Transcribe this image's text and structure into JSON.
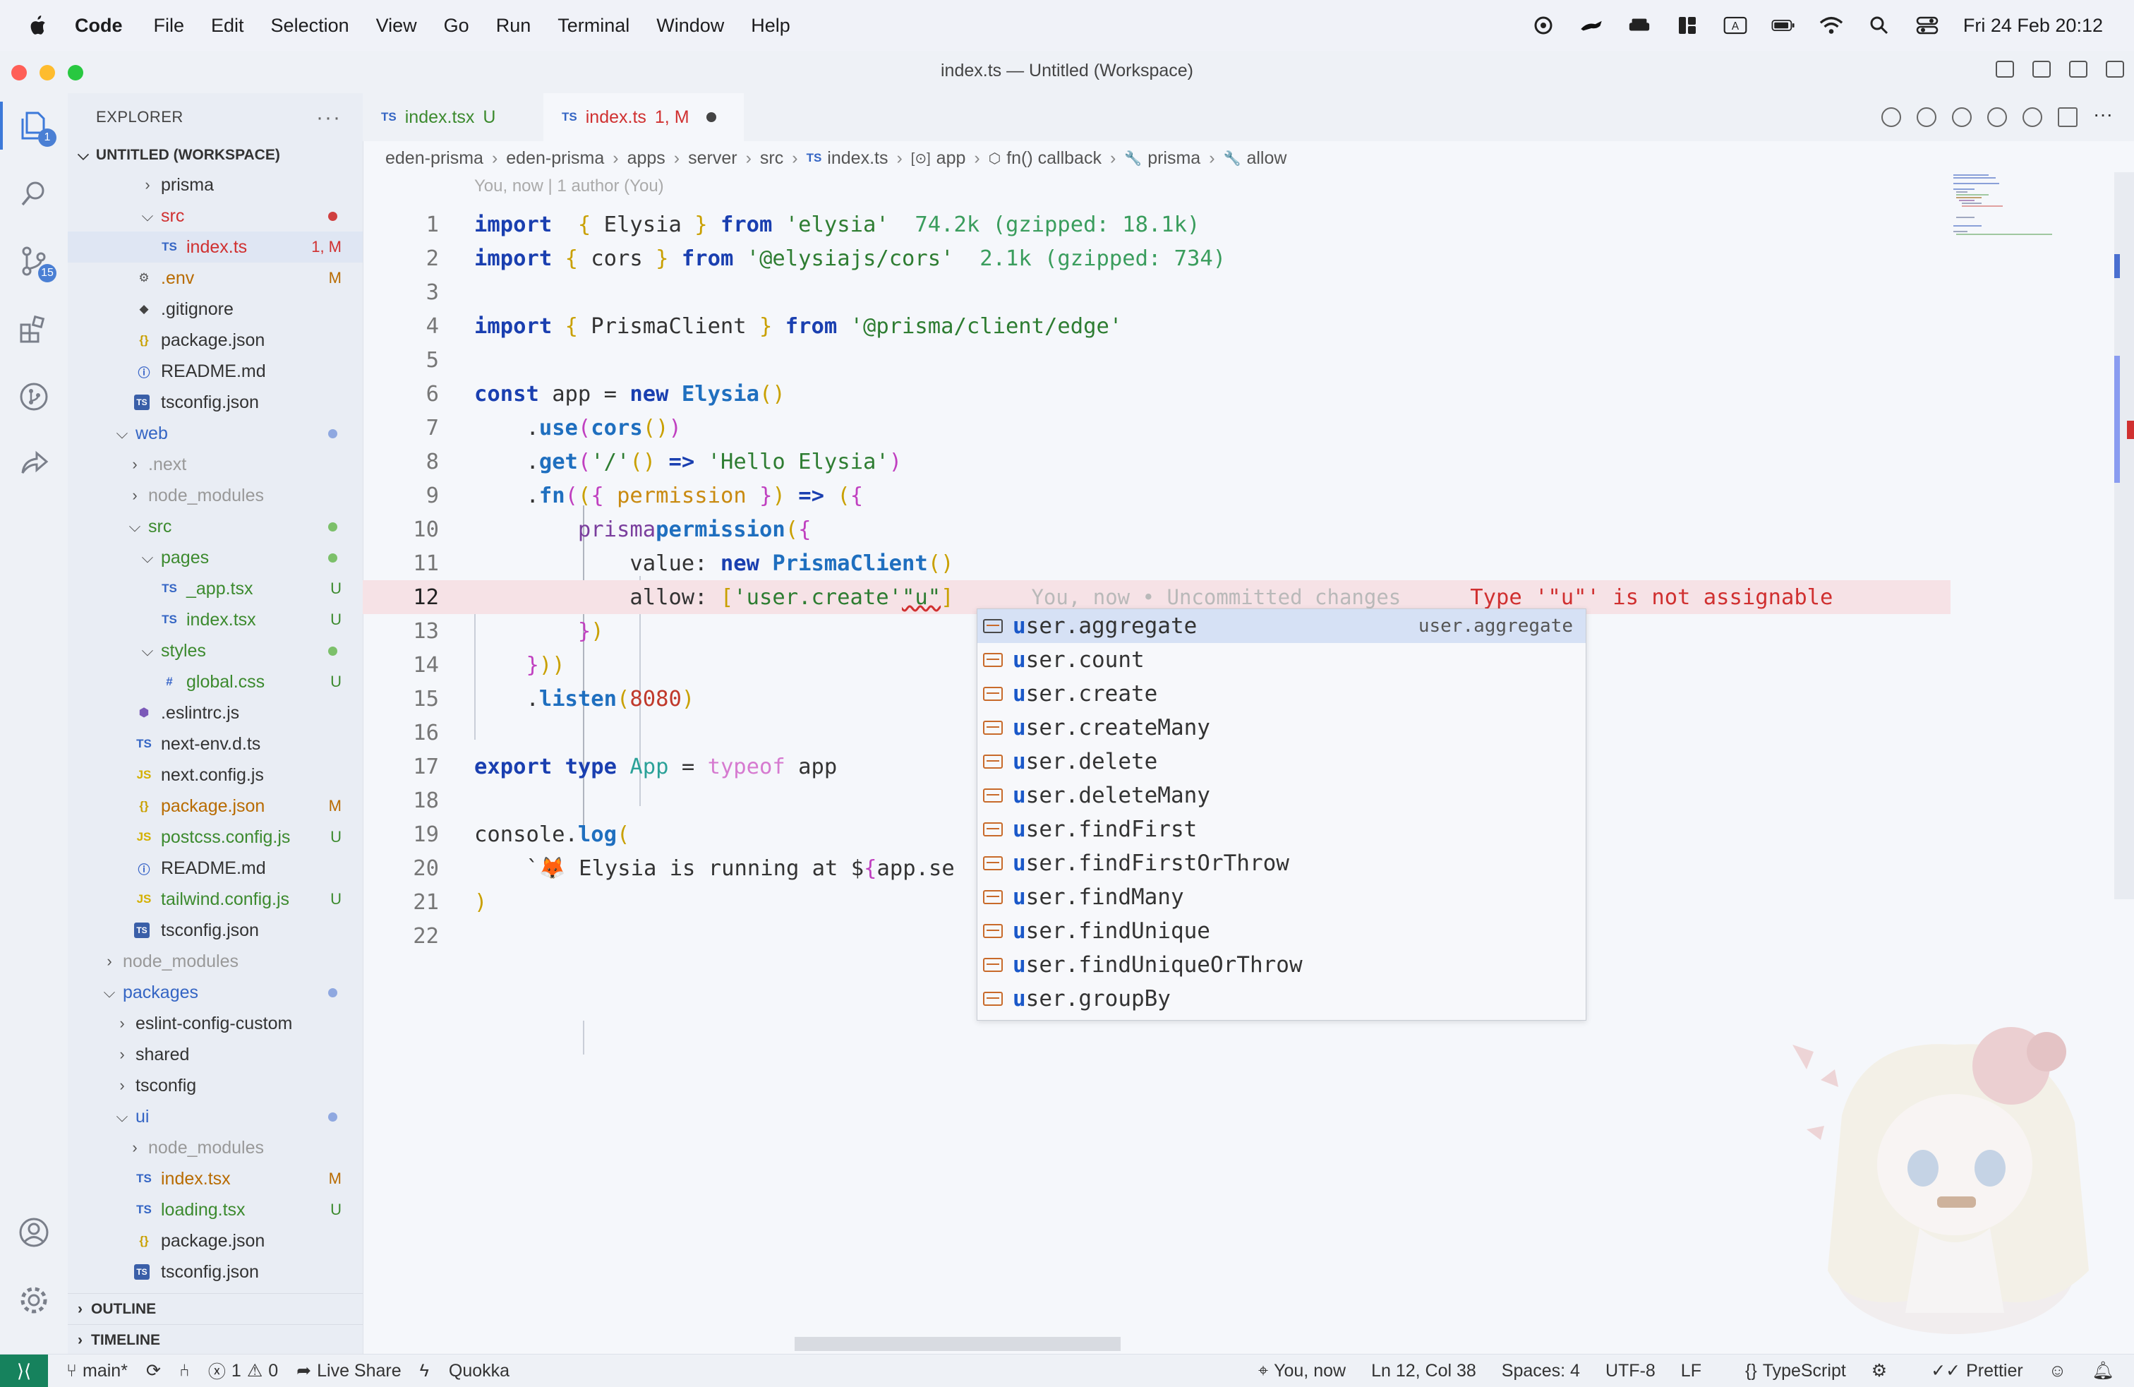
{
  "menubar": {
    "app": "Code",
    "items": [
      "File",
      "Edit",
      "Selection",
      "View",
      "Go",
      "Run",
      "Terminal",
      "Window",
      "Help"
    ],
    "clock": "Fri 24 Feb  20:12"
  },
  "window": {
    "title": "index.ts — Untitled (Workspace)"
  },
  "activity": {
    "explorer_badge": "1",
    "scm_badge": "15"
  },
  "explorer": {
    "header": "EXPLORER",
    "more": "···",
    "workspace": "UNTITLED (WORKSPACE)",
    "rows": [
      {
        "label": "prisma",
        "type": "folder",
        "open": false,
        "indent": 0
      },
      {
        "label": "src",
        "type": "folder",
        "open": true,
        "indent": 0,
        "color": "err",
        "dot": "#d04040"
      },
      {
        "label": "index.ts",
        "type": "ts",
        "indent": 1,
        "color": "err",
        "status": "1, M",
        "selected": true
      },
      {
        "label": ".env",
        "type": "gear",
        "indent": -1,
        "color": "mod",
        "status": "M"
      },
      {
        "label": ".gitignore",
        "type": "git",
        "indent": -1
      },
      {
        "label": "package.json",
        "type": "json",
        "indent": -1
      },
      {
        "label": "README.md",
        "type": "info",
        "indent": -1
      },
      {
        "label": "tsconfig.json",
        "type": "tsc",
        "indent": -1
      },
      {
        "label": "web",
        "type": "folder",
        "open": true,
        "indent": -2,
        "color": "blue",
        "dot": "#8fa8e0"
      },
      {
        "label": ".next",
        "type": "folder",
        "open": false,
        "indent": -1,
        "color": "dim"
      },
      {
        "label": "node_modules",
        "type": "folder",
        "open": false,
        "indent": -1,
        "color": "dim"
      },
      {
        "label": "src",
        "type": "folder",
        "open": true,
        "indent": -1,
        "color": "unt",
        "dot": "#7cc06a"
      },
      {
        "label": "pages",
        "type": "folder",
        "open": true,
        "indent": 0,
        "color": "unt",
        "dot": "#7cc06a"
      },
      {
        "label": "_app.tsx",
        "type": "ts",
        "indent": 1,
        "color": "unt",
        "status": "U"
      },
      {
        "label": "index.tsx",
        "type": "ts",
        "indent": 1,
        "color": "unt",
        "status": "U"
      },
      {
        "label": "styles",
        "type": "folder",
        "open": true,
        "indent": 0,
        "color": "unt",
        "dot": "#7cc06a"
      },
      {
        "label": "global.css",
        "type": "css",
        "indent": 1,
        "color": "unt",
        "status": "U"
      },
      {
        "label": ".eslintrc.js",
        "type": "eslint",
        "indent": -1
      },
      {
        "label": "next-env.d.ts",
        "type": "ts",
        "indent": -1
      },
      {
        "label": "next.config.js",
        "type": "js",
        "indent": -1
      },
      {
        "label": "package.json",
        "type": "json",
        "indent": -1,
        "color": "mod",
        "status": "M"
      },
      {
        "label": "postcss.config.js",
        "type": "js",
        "indent": -1,
        "color": "unt",
        "status": "U"
      },
      {
        "label": "README.md",
        "type": "info",
        "indent": -1
      },
      {
        "label": "tailwind.config.js",
        "type": "js",
        "indent": -1,
        "color": "unt",
        "status": "U"
      },
      {
        "label": "tsconfig.json",
        "type": "tsc",
        "indent": -1
      },
      {
        "label": "node_modules",
        "type": "folder",
        "open": false,
        "indent": -3,
        "color": "dim"
      },
      {
        "label": "packages",
        "type": "folder",
        "open": true,
        "indent": -3,
        "color": "blue",
        "dot": "#8fa8e0"
      },
      {
        "label": "eslint-config-custom",
        "type": "folder",
        "open": false,
        "indent": -2
      },
      {
        "label": "shared",
        "type": "folder",
        "open": false,
        "indent": -2
      },
      {
        "label": "tsconfig",
        "type": "folder",
        "open": false,
        "indent": -2
      },
      {
        "label": "ui",
        "type": "folder",
        "open": true,
        "indent": -2,
        "color": "blue",
        "dot": "#8fa8e0"
      },
      {
        "label": "node_modules",
        "type": "folder",
        "open": false,
        "indent": -1,
        "color": "dim"
      },
      {
        "label": "index.tsx",
        "type": "ts",
        "indent": -1,
        "color": "mod",
        "status": "M"
      },
      {
        "label": "loading.tsx",
        "type": "ts",
        "indent": -1,
        "color": "unt",
        "status": "U"
      },
      {
        "label": "package.json",
        "type": "json",
        "indent": -1
      },
      {
        "label": "tsconfig.json",
        "type": "tsc",
        "indent": -1
      }
    ],
    "outline": "OUTLINE",
    "timeline": "TIMELINE"
  },
  "tabs": [
    {
      "badge": "TS",
      "name": "index.tsx",
      "status": "U"
    },
    {
      "badge": "TS",
      "name": "index.ts",
      "status": "1, M"
    }
  ],
  "breadcrumbs": [
    "eden-prisma",
    "eden-prisma",
    "apps",
    "server",
    "src",
    "index.ts",
    "app",
    "fn() callback",
    "prisma",
    "allow"
  ],
  "breadcrumb_icons": {
    "index.ts": "TS",
    "app": "[⊙]",
    "fn() callback": "⬡",
    "prisma": "🔧",
    "allow": "🔧"
  },
  "editor": {
    "codelens": "You, now | 1 author (You)",
    "lines": [
      {
        "n": "1",
        "tokens": [
          [
            "kw",
            "import"
          ],
          [
            "",
            "  "
          ],
          [
            "brk",
            "{"
          ],
          [
            "",
            " Elysia "
          ],
          [
            "brk",
            "}"
          ],
          [
            "",
            " "
          ],
          [
            "kw",
            "from"
          ],
          [
            "",
            " "
          ],
          [
            "str",
            "'elysia'"
          ],
          [
            "hint",
            "  74.2k (gzipped: 18.1k)"
          ]
        ]
      },
      {
        "n": "2",
        "tokens": [
          [
            "kw",
            "import"
          ],
          [
            "",
            " "
          ],
          [
            "brk",
            "{"
          ],
          [
            "",
            " cors "
          ],
          [
            "brk",
            "}"
          ],
          [
            "",
            " "
          ],
          [
            "kw",
            "from"
          ],
          [
            "",
            " "
          ],
          [
            "str",
            "'@elysiajs/cors'"
          ],
          [
            "hint",
            "  2.1k (gzipped: 734)"
          ]
        ]
      },
      {
        "n": "3",
        "tokens": []
      },
      {
        "n": "4",
        "tokens": [
          [
            "kw",
            "import"
          ],
          [
            "",
            " "
          ],
          [
            "brk",
            "{"
          ],
          [
            "",
            " PrismaClient "
          ],
          [
            "brk",
            "}"
          ],
          [
            "",
            " "
          ],
          [
            "kw",
            "from"
          ],
          [
            "",
            " "
          ],
          [
            "str",
            "'@prisma/client/edge'"
          ]
        ]
      },
      {
        "n": "5",
        "tokens": []
      },
      {
        "n": "6",
        "tokens": [
          [
            "kw",
            "const"
          ],
          [
            "",
            " app = "
          ],
          [
            "kw",
            "new"
          ],
          [
            "",
            " "
          ],
          [
            "cls",
            "Elysia"
          ],
          [
            "brk",
            "()"
          ]
        ]
      },
      {
        "n": "7",
        "tokens": [
          [
            "",
            "    ."
          ],
          [
            "fn",
            "use"
          ],
          [
            "brk2",
            "("
          ],
          [
            "fn",
            "cors"
          ],
          [
            "brk",
            "()"
          ],
          [
            "brk2",
            ")"
          ]
        ]
      },
      {
        "n": "8",
        "tokens": [
          [
            "",
            "    ."
          ],
          [
            "fn",
            "get"
          ],
          [
            "brk2",
            "("
          ],
          [
            "str",
            "'/'"
          ],
          [
            ", "
          ],
          [
            "brk",
            "()"
          ],
          [
            "",
            " "
          ],
          [
            "kw",
            "=>"
          ],
          [
            "",
            " "
          ],
          [
            "str",
            "'Hello Elysia'"
          ],
          [
            "brk2",
            ")"
          ]
        ]
      },
      {
        "n": "9",
        "tokens": [
          [
            "",
            "    ."
          ],
          [
            "fn",
            "fn"
          ],
          [
            "brk2",
            "("
          ],
          [
            "brk",
            "("
          ],
          [
            "brk2",
            "{"
          ],
          [
            "",
            " "
          ],
          [
            "param",
            "permission"
          ],
          [
            "",
            " "
          ],
          [
            "brk2",
            "}"
          ],
          [
            "brk",
            ")"
          ],
          [
            "",
            " "
          ],
          [
            "kw",
            "=>"
          ],
          [
            "",
            " "
          ],
          [
            "brk",
            "("
          ],
          [
            "brk2",
            "{"
          ]
        ]
      },
      {
        "n": "10",
        "tokens": [
          [
            "",
            "        "
          ],
          [
            "prop",
            "prisma"
          ],
          [
            ": "
          ],
          [
            "fn",
            "permission"
          ],
          [
            "brk",
            "("
          ],
          [
            "brk2",
            "{"
          ]
        ]
      },
      {
        "n": "11",
        "tokens": [
          [
            "",
            "            value: "
          ],
          [
            "kw",
            "new"
          ],
          [
            "",
            " "
          ],
          [
            "cls",
            "PrismaClient"
          ],
          [
            "brk",
            "()"
          ],
          [
            ","
          ]
        ]
      },
      {
        "n": "12",
        "tokens": [
          [
            "",
            "            allow: "
          ],
          [
            "brk",
            "["
          ],
          [
            "str",
            "'user.create'"
          ],
          [
            ", "
          ],
          [
            "str",
            "\"u\""
          ],
          [
            "brk",
            "]"
          ]
        ],
        "blame": "You, now • Uncommitted changes",
        "error": "Type '\"u\"' is not assignable",
        "current": true
      },
      {
        "n": "13",
        "tokens": [
          [
            "",
            "        "
          ],
          [
            "brk2",
            "}"
          ],
          [
            "brk",
            ")"
          ]
        ]
      },
      {
        "n": "14",
        "tokens": [
          [
            "",
            "    "
          ],
          [
            "brk2",
            "}"
          ],
          [
            "brk",
            "))"
          ]
        ]
      },
      {
        "n": "15",
        "tokens": [
          [
            "",
            "    ."
          ],
          [
            "fn",
            "listen"
          ],
          [
            "brk",
            "("
          ],
          [
            "num",
            "8080"
          ],
          [
            "brk",
            ")"
          ]
        ]
      },
      {
        "n": "16",
        "tokens": []
      },
      {
        "n": "17",
        "tokens": [
          [
            "kw",
            "export"
          ],
          [
            "",
            " "
          ],
          [
            "kw",
            "type"
          ],
          [
            "",
            " "
          ],
          [
            "type",
            "App"
          ],
          [
            "",
            " = "
          ],
          [
            "typeof",
            "typeof"
          ],
          [
            "",
            " app"
          ]
        ]
      },
      {
        "n": "18",
        "tokens": []
      },
      {
        "n": "19",
        "tokens": [
          [
            "",
            "console."
          ],
          [
            "fn",
            "log"
          ],
          [
            "brk",
            "("
          ]
        ]
      },
      {
        "n": "20",
        "tokens": [
          [
            "",
            "    `🦊 Elysia is running at $"
          ],
          [
            "brk2",
            "{"
          ],
          [
            "",
            "app.se"
          ]
        ]
      },
      {
        "n": "21",
        "tokens": [
          [
            "brk",
            ")"
          ]
        ]
      },
      {
        "n": "22",
        "tokens": []
      }
    ]
  },
  "suggest": {
    "detail": "user.aggregate",
    "items": [
      "user.aggregate",
      "user.count",
      "user.create",
      "user.createMany",
      "user.delete",
      "user.deleteMany",
      "user.findFirst",
      "user.findFirstOrThrow",
      "user.findMany",
      "user.findUnique",
      "user.findUniqueOrThrow",
      "user.groupBy"
    ]
  },
  "statusbar": {
    "branch": "main*",
    "errors": "1",
    "warnings": "0",
    "liveshare": "Live Share",
    "quokka": "Quokka",
    "blame": "You, now",
    "position": "Ln 12, Col 38",
    "spaces": "Spaces: 4",
    "encoding": "UTF-8",
    "eol": "LF",
    "language": "TypeScript",
    "prettier": "Prettier"
  }
}
